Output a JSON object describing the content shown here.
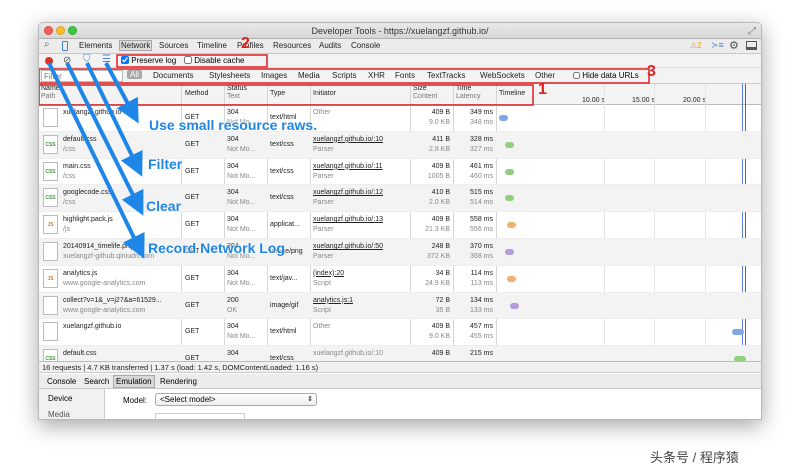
{
  "window": {
    "title": "Developer Tools - https://xuelangzf.github.io/"
  },
  "panel_tabs": [
    "Elements",
    "Network",
    "Sources",
    "Timeline",
    "Profiles",
    "Resources",
    "Audits",
    "Console"
  ],
  "warning_count": "2",
  "toolbar": {
    "preserve_log": "Preserve log",
    "disable_cache": "Disable cache"
  },
  "filter": {
    "placeholder": "Filter",
    "types": [
      "All",
      "Documents",
      "Stylesheets",
      "Images",
      "Media",
      "Scripts",
      "XHR",
      "Fonts",
      "TextTracks",
      "WebSockets",
      "Other"
    ],
    "hide_data_urls": "Hide data URLs"
  },
  "columns": {
    "name": "Name",
    "name_sub": "Path",
    "method": "Method",
    "status": "Status",
    "status_sub": "Text",
    "type": "Type",
    "initiator": "Initiator",
    "size": "Size",
    "size_sub": "Content",
    "time": "Time",
    "time_sub": "Latency",
    "timeline": "Timeline",
    "ticks": [
      "10.00 s",
      "15.00 s",
      "20.00 s"
    ]
  },
  "rows": [
    {
      "icon": "html-file-icon",
      "icon_text": "",
      "name": "xuelangzf.github.io",
      "path": "",
      "method": "GET",
      "status": "304",
      "status_text": "Not Mo...",
      "type": "text/html",
      "initiator": "Other",
      "initiator_sub": "",
      "size": "409 B",
      "content": "9.0 KB",
      "time": "349 ms",
      "latency": "348 ms",
      "wf_color": "#7fa6e6"
    },
    {
      "icon": "css-file-icon",
      "icon_text": "CSS",
      "name": "default.css",
      "path": "/css",
      "method": "GET",
      "status": "304",
      "status_text": "Not Mo...",
      "type": "text/css",
      "initiator": "xuelangzf.github.io/:10",
      "initiator_sub": "Parser",
      "size": "411 B",
      "content": "2.8 KB",
      "time": "328 ms",
      "latency": "327 ms",
      "wf_color": "#8fcf7f"
    },
    {
      "icon": "css-file-icon",
      "icon_text": "CSS",
      "name": "main.css",
      "path": "/css",
      "method": "GET",
      "status": "304",
      "status_text": "Not Mo...",
      "type": "text/css",
      "initiator": "xuelangzf.github.io/:11",
      "initiator_sub": "Parser",
      "size": "409 B",
      "content": "1005 B",
      "time": "461 ms",
      "latency": "460 ms",
      "wf_color": "#8fcf7f"
    },
    {
      "icon": "css-file-icon",
      "icon_text": "CSS",
      "name": "googlecode.css",
      "path": "/css",
      "method": "GET",
      "status": "304",
      "status_text": "Not Mo...",
      "type": "text/css",
      "initiator": "xuelangzf.github.io/:12",
      "initiator_sub": "Parser",
      "size": "410 B",
      "content": "2.0 KB",
      "time": "515 ms",
      "latency": "514 ms",
      "wf_color": "#8fcf7f"
    },
    {
      "icon": "js-file-icon",
      "icon_text": "JS",
      "name": "highlight.pack.js",
      "path": "/js",
      "method": "GET",
      "status": "304",
      "status_text": "Not Mo...",
      "type": "applicat...",
      "initiator": "xuelangzf.github.io/:13",
      "initiator_sub": "Parser",
      "size": "409 B",
      "content": "21.3 KB",
      "time": "558 ms",
      "latency": "556 ms",
      "wf_color": "#f0b070"
    },
    {
      "icon": "image-file-icon",
      "icon_text": "",
      "name": "20140914_timelife.png",
      "path": "xuelangzf-github.qiniudn.com",
      "method": "GET",
      "status": "304",
      "status_text": "Not Mo...",
      "type": "image/png",
      "initiator": "xuelangzf.github.io/:50",
      "initiator_sub": "Parser",
      "size": "248 B",
      "content": "372 KB",
      "time": "370 ms",
      "latency": "368 ms",
      "wf_color": "#b69ae0"
    },
    {
      "icon": "js-file-icon",
      "icon_text": "JS",
      "name": "analytics.js",
      "path": "www.google-analytics.com",
      "method": "GET",
      "status": "304",
      "status_text": "Not Mo...",
      "type": "text/jav...",
      "initiator": "(index):20",
      "initiator_sub": "Script",
      "size": "34 B",
      "content": "24.9 KB",
      "time": "114 ms",
      "latency": "113 ms",
      "wf_color": "#f0b070"
    },
    {
      "icon": "blank-file-icon",
      "icon_text": "",
      "name": "collect?v=1&_v=j27&a=61529...",
      "path": "www.google-analytics.com",
      "method": "GET",
      "status": "200",
      "status_text": "OK",
      "type": "image/gif",
      "initiator": "analytics.js:1",
      "initiator_sub": "Script",
      "size": "72 B",
      "content": "35 B",
      "time": "134 ms",
      "latency": "133 ms",
      "wf_color": "#b69ae0"
    },
    {
      "icon": "html-file-icon",
      "icon_text": "",
      "name": "xuelangzf.github.io",
      "path": "",
      "method": "GET",
      "status": "304",
      "status_text": "Not Mo...",
      "type": "text/html",
      "initiator": "Other",
      "initiator_sub": "",
      "size": "409 B",
      "content": "9.0 KB",
      "time": "457 ms",
      "latency": "455 ms",
      "wf_color": "#7fa6e6"
    },
    {
      "icon": "css-file-icon",
      "icon_text": "CSS",
      "name": "default.css",
      "path": "",
      "method": "GET",
      "status": "304",
      "status_text": "",
      "type": "text/css",
      "initiator": "xuelangzf.github.io/:10",
      "initiator_sub": "",
      "size": "409 B",
      "content": "",
      "time": "215 ms",
      "latency": "",
      "wf_color": "#8fcf7f"
    }
  ],
  "status_bar": "16 requests | 4.7 KB transferred | 1.37 s (load: 1.42 s, DOMContentLoaded: 1.16 s)",
  "drawer_tabs": [
    "Console",
    "Search",
    "Emulation",
    "Rendering"
  ],
  "drawer": {
    "side_items": [
      "Device",
      "Media"
    ],
    "model_label": "Model:",
    "model_value": "<Select model>"
  },
  "annotations": {
    "callouts": [
      "Use small resource raws.",
      "Filter",
      "Clear",
      "Record Network Log"
    ],
    "numbers": [
      "1",
      "2",
      "3"
    ]
  },
  "watermark": "头条号 / 程序猿",
  "colors": {
    "record": "#e03020",
    "callout": "#1e86e6",
    "badge": "#e02020"
  }
}
